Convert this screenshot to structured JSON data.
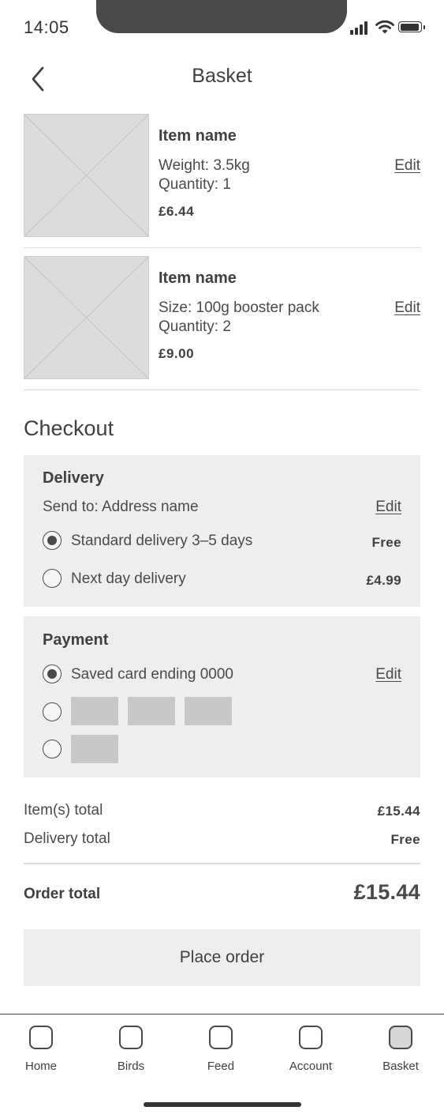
{
  "status_bar": {
    "time": "14:05"
  },
  "header": {
    "title": "Basket"
  },
  "basket": {
    "items": [
      {
        "name": "Item name",
        "detail_1": "Weight: 3.5kg",
        "detail_2": "Quantity: 1",
        "price": "£6.44",
        "edit_label": "Edit"
      },
      {
        "name": "Item name",
        "detail_1": "Size: 100g booster pack",
        "detail_2": "Quantity: 2",
        "price": "£9.00",
        "edit_label": "Edit"
      }
    ]
  },
  "checkout": {
    "title": "Checkout",
    "delivery": {
      "title": "Delivery",
      "send_to": "Send to: Address name",
      "edit_label": "Edit",
      "options": [
        {
          "label": "Standard delivery 3–5 days",
          "price": "Free",
          "selected": true
        },
        {
          "label": "Next day delivery",
          "price": "£4.99",
          "selected": false
        }
      ]
    },
    "payment": {
      "title": "Payment",
      "edit_label": "Edit",
      "options": [
        {
          "label": "Saved card ending 0000",
          "selected": true
        },
        {
          "label": "",
          "selected": false
        },
        {
          "label": "",
          "selected": false
        }
      ]
    }
  },
  "totals": {
    "items_label": "Item(s) total",
    "items_value": "£15.44",
    "delivery_label": "Delivery total",
    "delivery_value": "Free",
    "order_label": "Order total",
    "order_value": "£15.44"
  },
  "place_order_label": "Place order",
  "tab_bar": {
    "tabs": [
      {
        "label": "Home",
        "active": false
      },
      {
        "label": "Birds",
        "active": false
      },
      {
        "label": "Feed",
        "active": false
      },
      {
        "label": "Account",
        "active": false
      },
      {
        "label": "Basket",
        "active": true
      }
    ]
  }
}
